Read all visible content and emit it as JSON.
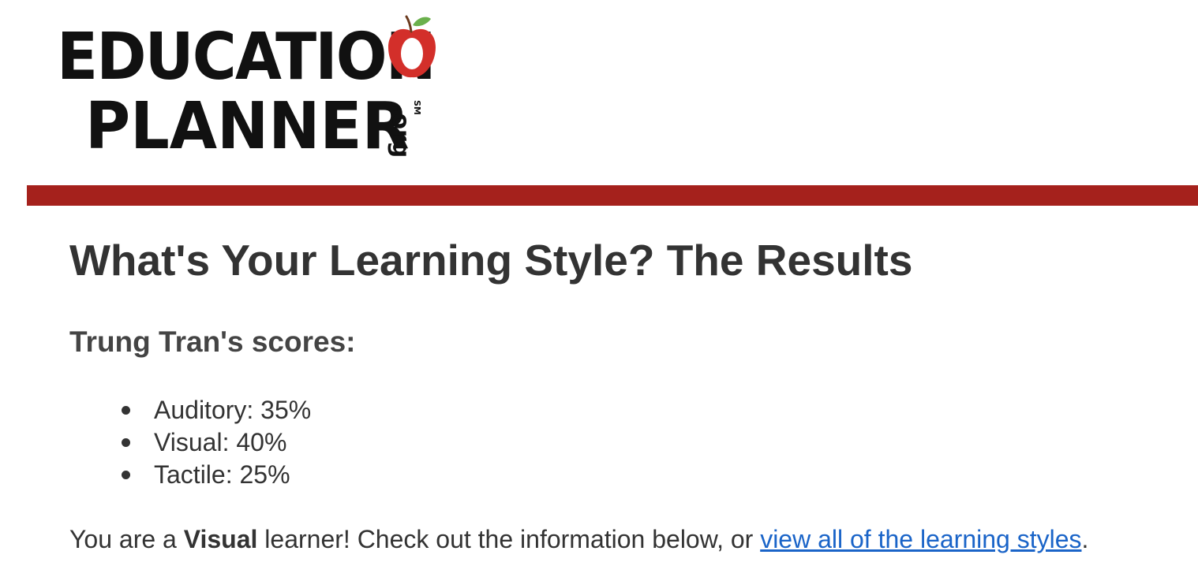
{
  "logo": {
    "line1": "EDUCATION",
    "line2": "PLANNER",
    "org": ".org",
    "sm": "SM",
    "apple_icon": "apple-icon",
    "colors": {
      "text": "#111111",
      "apple": "#d32f2a",
      "leaf": "#6ab04c"
    }
  },
  "divider_color": "#a5211c",
  "page_title": "What's Your Learning Style? The Results",
  "scores": {
    "heading": "Trung Tran's scores:",
    "items": [
      {
        "label": "Auditory: 35%",
        "percent": 35
      },
      {
        "label": "Visual: 40%",
        "percent": 40
      },
      {
        "label": "Tactile: 25%",
        "percent": 25
      }
    ]
  },
  "summary": {
    "prefix": "You are a ",
    "style": "Visual",
    "middle": " learner! Check out the information below, or ",
    "link_text": "view all of the learning styles",
    "suffix": ".",
    "link_color": "#1a64c8"
  }
}
